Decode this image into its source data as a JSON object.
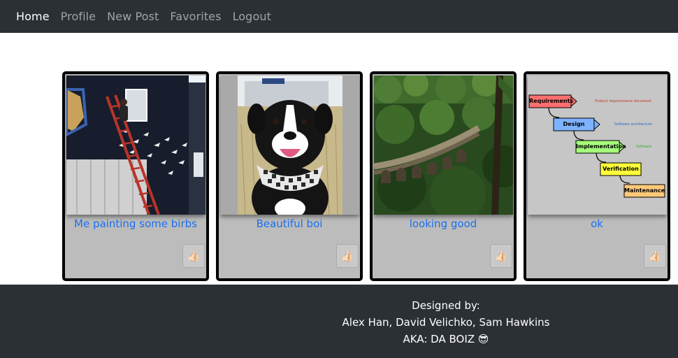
{
  "nav": {
    "home": "Home",
    "profile": "Profile",
    "new_post": "New Post",
    "favorites": "Favorites",
    "logout": "Logout"
  },
  "posts": [
    {
      "title": "Me painting some birbs",
      "like_icon": "👍🏻"
    },
    {
      "title": "Beautiful boi",
      "like_icon": "👍🏻"
    },
    {
      "title": "looking good",
      "like_icon": "👍🏻"
    },
    {
      "title": "ok",
      "like_icon": "👍🏻"
    }
  ],
  "diagram": {
    "requirements": "Requirements",
    "requirements_note": "Product requirements document",
    "design": "Design",
    "design_note": "Software architecture",
    "implementation": "Implementation",
    "implementation_note": "Software",
    "verification": "Verification",
    "maintenance": "Maintenance"
  },
  "footer": {
    "designed_by": "Designed by:",
    "names": "Alex Han, David Velichko, Sam Hawkins",
    "aka": "AKA: DA BOIZ 😎"
  },
  "colors": {
    "navbar": "#2b3035",
    "link": "#1a6ff0",
    "card": "#bcbcbc"
  }
}
